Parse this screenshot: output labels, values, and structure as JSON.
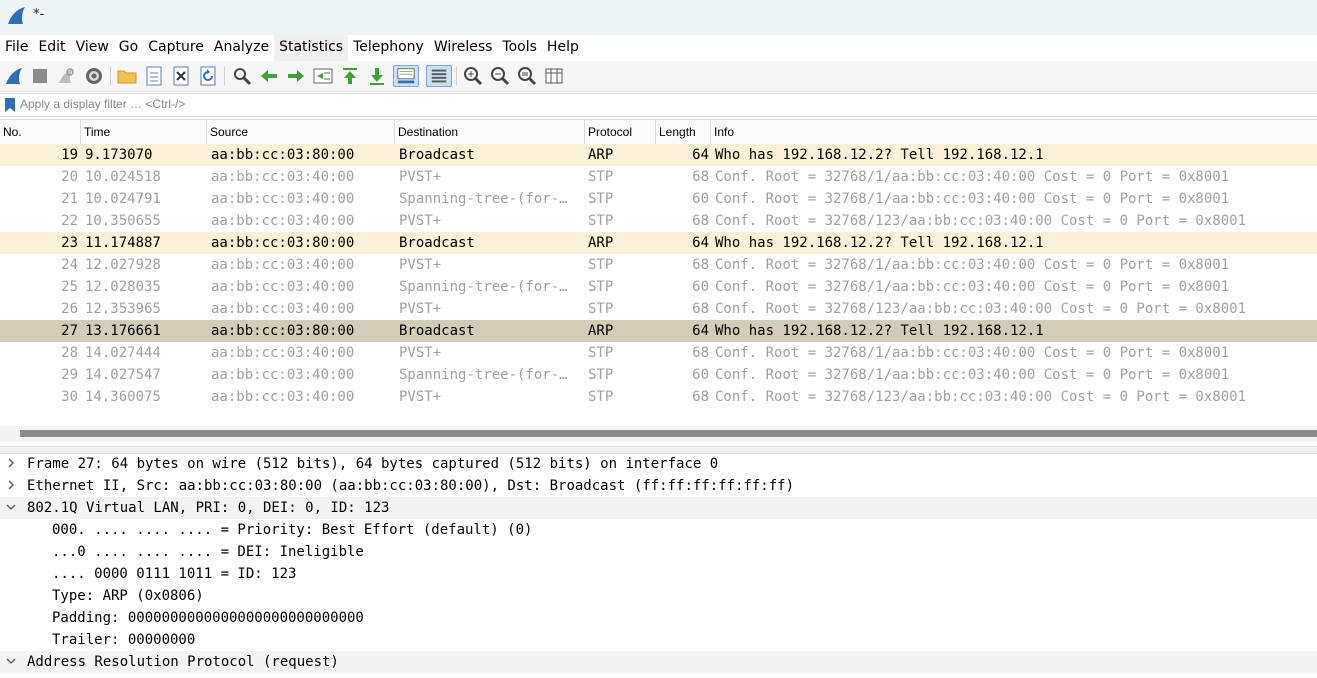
{
  "window": {
    "title": "*-"
  },
  "menu": [
    "File",
    "Edit",
    "View",
    "Go",
    "Capture",
    "Analyze",
    "Statistics",
    "Telephony",
    "Wireless",
    "Tools",
    "Help"
  ],
  "filter": {
    "placeholder": "Apply a display filter … <Ctrl-/>"
  },
  "columns": [
    "No.",
    "Time",
    "Source",
    "Destination",
    "Protocol",
    "Length",
    "Info"
  ],
  "colors": {
    "arp_row": "#faf0d7",
    "selected_row": "#d3ccb8",
    "stp_text": "#a0a0a0",
    "normal_text": "#000000",
    "icon_blue": "#2d6fb7",
    "icon_green": "#3fa234"
  },
  "packets": [
    {
      "no": "19",
      "time": "9.173070",
      "src": "aa:bb:cc:03:80:00",
      "dst": "Broadcast",
      "proto": "ARP",
      "len": "64",
      "info": "Who has 192.168.12.2? Tell 192.168.12.1",
      "style": "arp"
    },
    {
      "no": "20",
      "time": "10.024518",
      "src": "aa:bb:cc:03:40:00",
      "dst": "PVST+",
      "proto": "STP",
      "len": "68",
      "info": "Conf. Root = 32768/1/aa:bb:cc:03:40:00  Cost = 0  Port = 0x8001",
      "style": "stp"
    },
    {
      "no": "21",
      "time": "10.024791",
      "src": "aa:bb:cc:03:40:00",
      "dst": "Spanning-tree-(for-…",
      "proto": "STP",
      "len": "60",
      "info": "Conf. Root = 32768/1/aa:bb:cc:03:40:00  Cost = 0  Port = 0x8001",
      "style": "stp"
    },
    {
      "no": "22",
      "time": "10.350655",
      "src": "aa:bb:cc:03:40:00",
      "dst": "PVST+",
      "proto": "STP",
      "len": "68",
      "info": "Conf. Root = 32768/123/aa:bb:cc:03:40:00  Cost = 0  Port = 0x8001",
      "style": "stp"
    },
    {
      "no": "23",
      "time": "11.174887",
      "src": "aa:bb:cc:03:80:00",
      "dst": "Broadcast",
      "proto": "ARP",
      "len": "64",
      "info": "Who has 192.168.12.2? Tell 192.168.12.1",
      "style": "arp"
    },
    {
      "no": "24",
      "time": "12.027928",
      "src": "aa:bb:cc:03:40:00",
      "dst": "PVST+",
      "proto": "STP",
      "len": "68",
      "info": "Conf. Root = 32768/1/aa:bb:cc:03:40:00  Cost = 0  Port = 0x8001",
      "style": "stp"
    },
    {
      "no": "25",
      "time": "12.028035",
      "src": "aa:bb:cc:03:40:00",
      "dst": "Spanning-tree-(for-…",
      "proto": "STP",
      "len": "60",
      "info": "Conf. Root = 32768/1/aa:bb:cc:03:40:00  Cost = 0  Port = 0x8001",
      "style": "stp"
    },
    {
      "no": "26",
      "time": "12.353965",
      "src": "aa:bb:cc:03:40:00",
      "dst": "PVST+",
      "proto": "STP",
      "len": "68",
      "info": "Conf. Root = 32768/123/aa:bb:cc:03:40:00  Cost = 0  Port = 0x8001",
      "style": "stp"
    },
    {
      "no": "27",
      "time": "13.176661",
      "src": "aa:bb:cc:03:80:00",
      "dst": "Broadcast",
      "proto": "ARP",
      "len": "64",
      "info": "Who has 192.168.12.2? Tell 192.168.12.1",
      "style": "selected"
    },
    {
      "no": "28",
      "time": "14.027444",
      "src": "aa:bb:cc:03:40:00",
      "dst": "PVST+",
      "proto": "STP",
      "len": "68",
      "info": "Conf. Root = 32768/1/aa:bb:cc:03:40:00  Cost = 0  Port = 0x8001",
      "style": "stp"
    },
    {
      "no": "29",
      "time": "14.027547",
      "src": "aa:bb:cc:03:40:00",
      "dst": "Spanning-tree-(for-…",
      "proto": "STP",
      "len": "60",
      "info": "Conf. Root = 32768/1/aa:bb:cc:03:40:00  Cost = 0  Port = 0x8001",
      "style": "stp"
    },
    {
      "no": "30",
      "time": "14.360075",
      "src": "aa:bb:cc:03:40:00",
      "dst": "PVST+",
      "proto": "STP",
      "len": "68",
      "info": "Conf. Root = 32768/123/aa:bb:cc:03:40:00  Cost = 0  Port = 0x8001",
      "style": "stp"
    }
  ],
  "details": [
    {
      "text": "Frame 27: 64 bytes on wire (512 bits), 64 bytes captured (512 bits) on interface 0",
      "level": 0,
      "toggle": "collapsed"
    },
    {
      "text": "Ethernet II, Src: aa:bb:cc:03:80:00 (aa:bb:cc:03:80:00), Dst: Broadcast (ff:ff:ff:ff:ff:ff)",
      "level": 0,
      "toggle": "collapsed"
    },
    {
      "text": "802.1Q Virtual LAN, PRI: 0, DEI: 0, ID: 123",
      "level": 0,
      "toggle": "expanded"
    },
    {
      "text": "000. .... .... .... = Priority: Best Effort (default) (0)",
      "level": 1,
      "toggle": "none"
    },
    {
      "text": "...0 .... .... .... = DEI: Ineligible",
      "level": 1,
      "toggle": "none"
    },
    {
      "text": ".... 0000 0111 1011 = ID: 123",
      "level": 1,
      "toggle": "none"
    },
    {
      "text": "Type: ARP (0x0806)",
      "level": 1,
      "toggle": "none"
    },
    {
      "text": "Padding: 0000000000000000000000000000",
      "level": 1,
      "toggle": "none"
    },
    {
      "text": "Trailer: 00000000",
      "level": 1,
      "toggle": "none"
    },
    {
      "text": "Address Resolution Protocol (request)",
      "level": 0,
      "toggle": "expanded"
    }
  ]
}
